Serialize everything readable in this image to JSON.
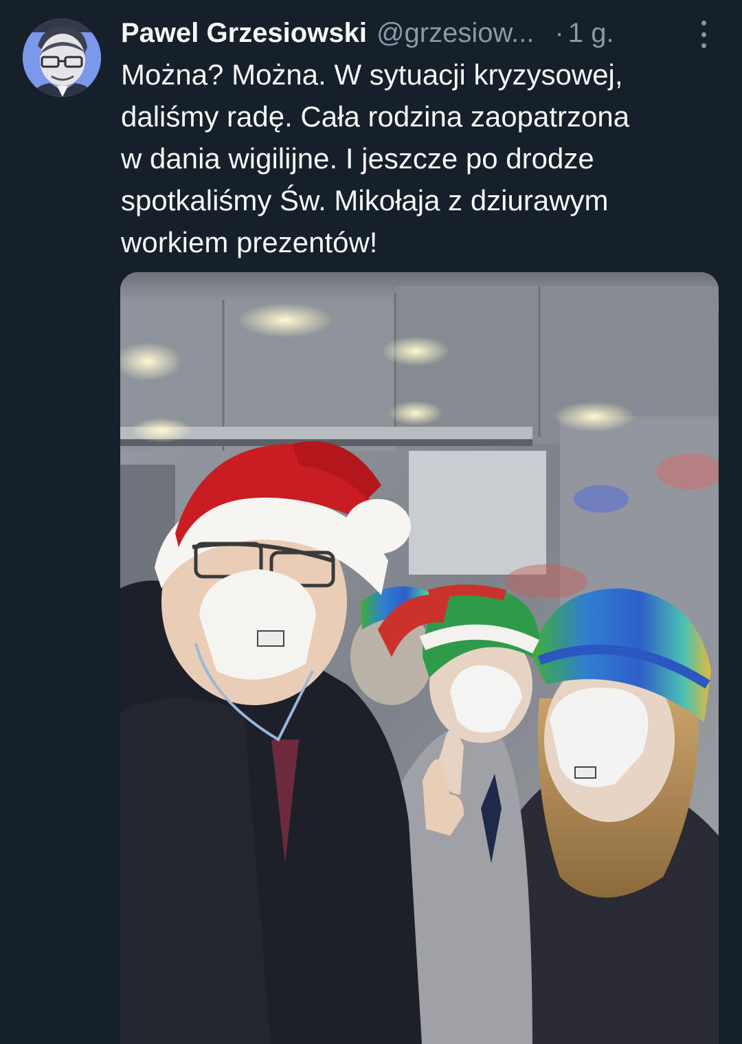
{
  "author": {
    "name": "Pawel Grzesiowski",
    "handle": "@grzesiow...",
    "time_separator": "·",
    "time": "1 g."
  },
  "tweet": {
    "lines": [
      "Można? Można. W sytuacji kryzysowej,",
      "daliśmy radę. Cała rodzina zaopatrzona",
      "w dania wigilijne. I jeszcze po drodze",
      "spotkaliśmy Św. Mikołaja z dziurawym",
      "workiem prezentów!"
    ]
  },
  "icons": {
    "avatar": "profile-photo",
    "more": "more-options-icon"
  },
  "colors": {
    "background": "#15202b",
    "text": "#f7f9f9",
    "secondary": "#8b98a5"
  }
}
